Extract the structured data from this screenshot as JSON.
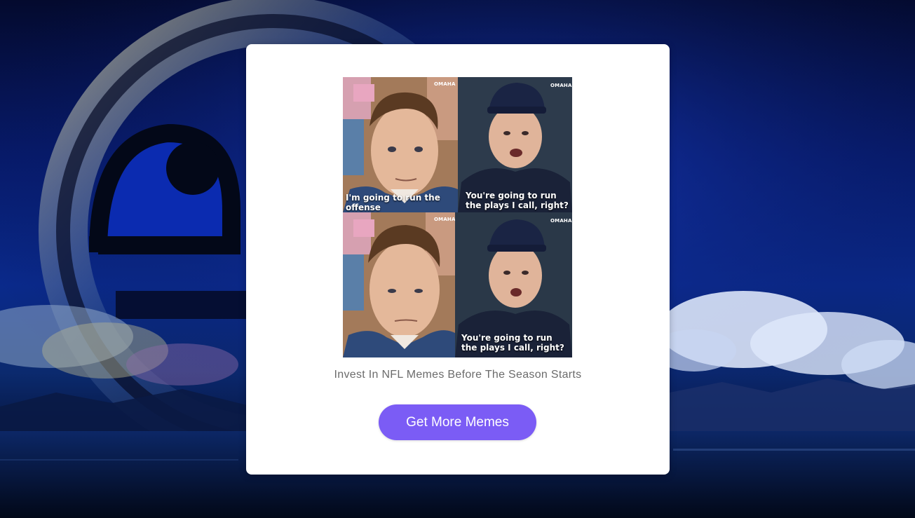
{
  "meme": {
    "panels": [
      {
        "caption": "I'm going to run the\noffense",
        "watermark": "OMAHA"
      },
      {
        "caption": "You're going to run\nthe plays I call, right?",
        "watermark": "OMAHA"
      },
      {
        "caption": "",
        "watermark": "OMAHA"
      },
      {
        "caption": "You're going to run\nthe plays I call, right?",
        "watermark": "OMAHA"
      }
    ]
  },
  "subtitle": "Invest In NFL Memes Before The Season Starts",
  "cta_label": "Get More Memes",
  "colors": {
    "button": "#7b5cf5",
    "card": "#ffffff",
    "subtitle": "#6b6b6b",
    "background_top": "#040a2e",
    "background_mid": "#0a2a8c"
  }
}
